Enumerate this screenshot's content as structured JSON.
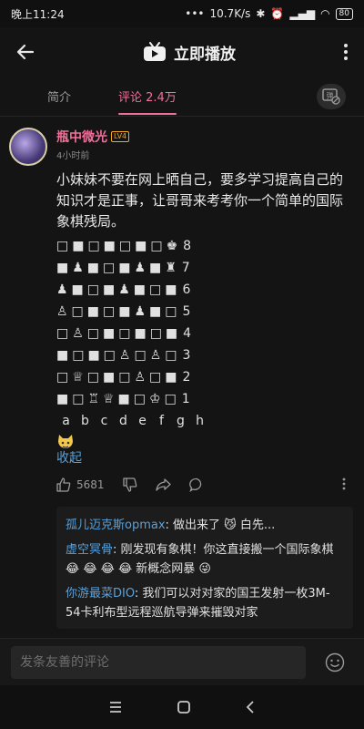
{
  "status_bar": {
    "time": "晚上11:24",
    "network_speed": "10.7K/s",
    "battery": "80"
  },
  "header": {
    "title": "立即播放"
  },
  "tabs": [
    {
      "label": "简介"
    },
    {
      "label": "评论 2.4万",
      "active": true
    }
  ],
  "comment": {
    "username": "瓶中微光",
    "level": "LV4",
    "timestamp": "4小时前",
    "text": "小妹妹不要在网上晒自己，要多学习提高自己的知识才是正事，让哥哥来考考你一个简单的国际象棋残局。",
    "board_rows": [
      {
        "squares": "□■□■□■□♚",
        "rank": "8"
      },
      {
        "squares": "■♟■□■♟■♜",
        "rank": "7"
      },
      {
        "squares": "♟■□■♟■□■",
        "rank": "6"
      },
      {
        "squares": "♙□■□■♟■□",
        "rank": "5"
      },
      {
        "squares": "□♙□■□■□■",
        "rank": "4"
      },
      {
        "squares": "■□■□♙□♙□",
        "rank": "3"
      },
      {
        "squares": "□♕□■□♙□■",
        "rank": "2"
      },
      {
        "squares": "■□♖♕■□♔□",
        "rank": "1"
      }
    ],
    "files": [
      "a",
      "b",
      "c",
      "d",
      "e",
      "f",
      "g",
      "h"
    ],
    "collapse_label": "收起",
    "like_count": "5681"
  },
  "replies": [
    {
      "user": "孤儿迈克斯opmax",
      "text": ": 做出来了 😼 白先..."
    },
    {
      "user": "虚空冥骨",
      "text": ": 刚发现有象棋！你这直接搬一个国际象棋 😂 😂 😂 😂 新概念网暴 😜"
    },
    {
      "user": "你游最菜DIO",
      "text": ": 我们可以对对家的国王发射一枚3M-54卡利布型远程巡航导弹来摧毁对家"
    }
  ],
  "input": {
    "placeholder": "发条友善的评论"
  },
  "colors": {
    "accent": "#f0709a",
    "link": "#5aa0d8",
    "background": "#141414"
  }
}
